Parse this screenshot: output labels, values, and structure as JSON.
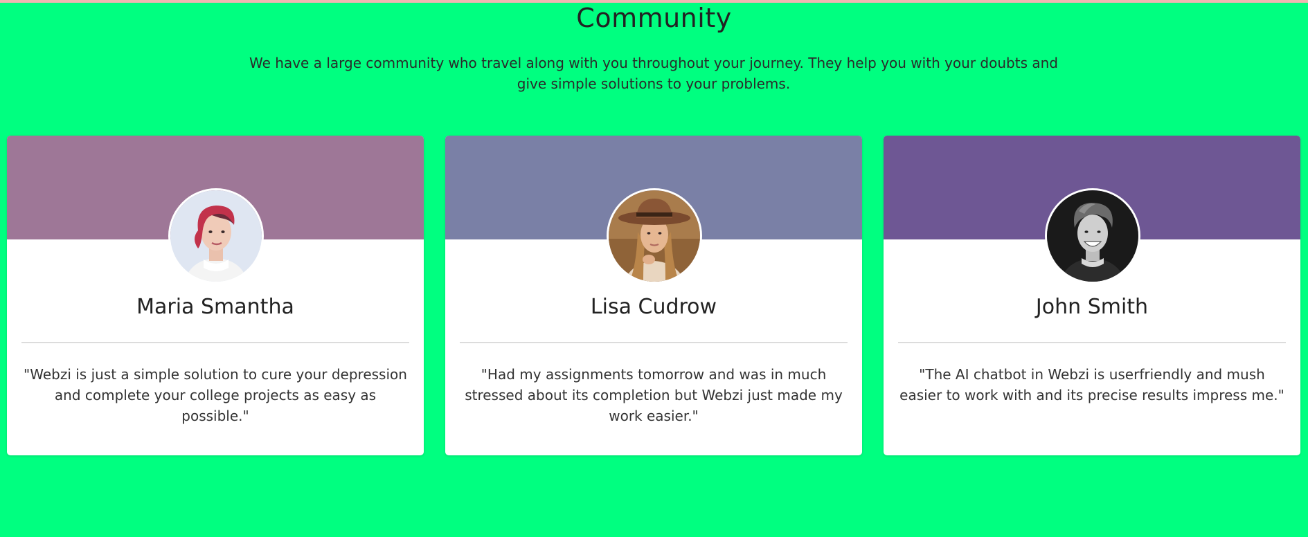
{
  "section": {
    "title": "Community",
    "description": "We have a large community who travel along with you throughout your journey. They help you with your doubts and give simple solutions to your problems."
  },
  "cards": [
    {
      "name": "Maria Smantha",
      "quote": "\"Webzi is just a simple solution to cure your depression and complete your college projects as easy as possible.\"",
      "banner_color": "#9e7797",
      "avatar_icon": "woman-portrait-icon"
    },
    {
      "name": "Lisa Cudrow",
      "quote": "\"Had my assignments tomorrow and was in much stressed about its completion but Webzi just made my work easier.\"",
      "banner_color": "#7a80a6",
      "avatar_icon": "woman-hat-portrait-icon"
    },
    {
      "name": "John Smith",
      "quote": "\"The AI chatbot in Webzi is userfriendly and mush easier to work with and its precise results impress me.\"",
      "banner_color": "#6e5794",
      "avatar_icon": "man-portrait-icon"
    }
  ],
  "colors": {
    "page_background": "#00ff80",
    "card_background": "#ffffff"
  }
}
